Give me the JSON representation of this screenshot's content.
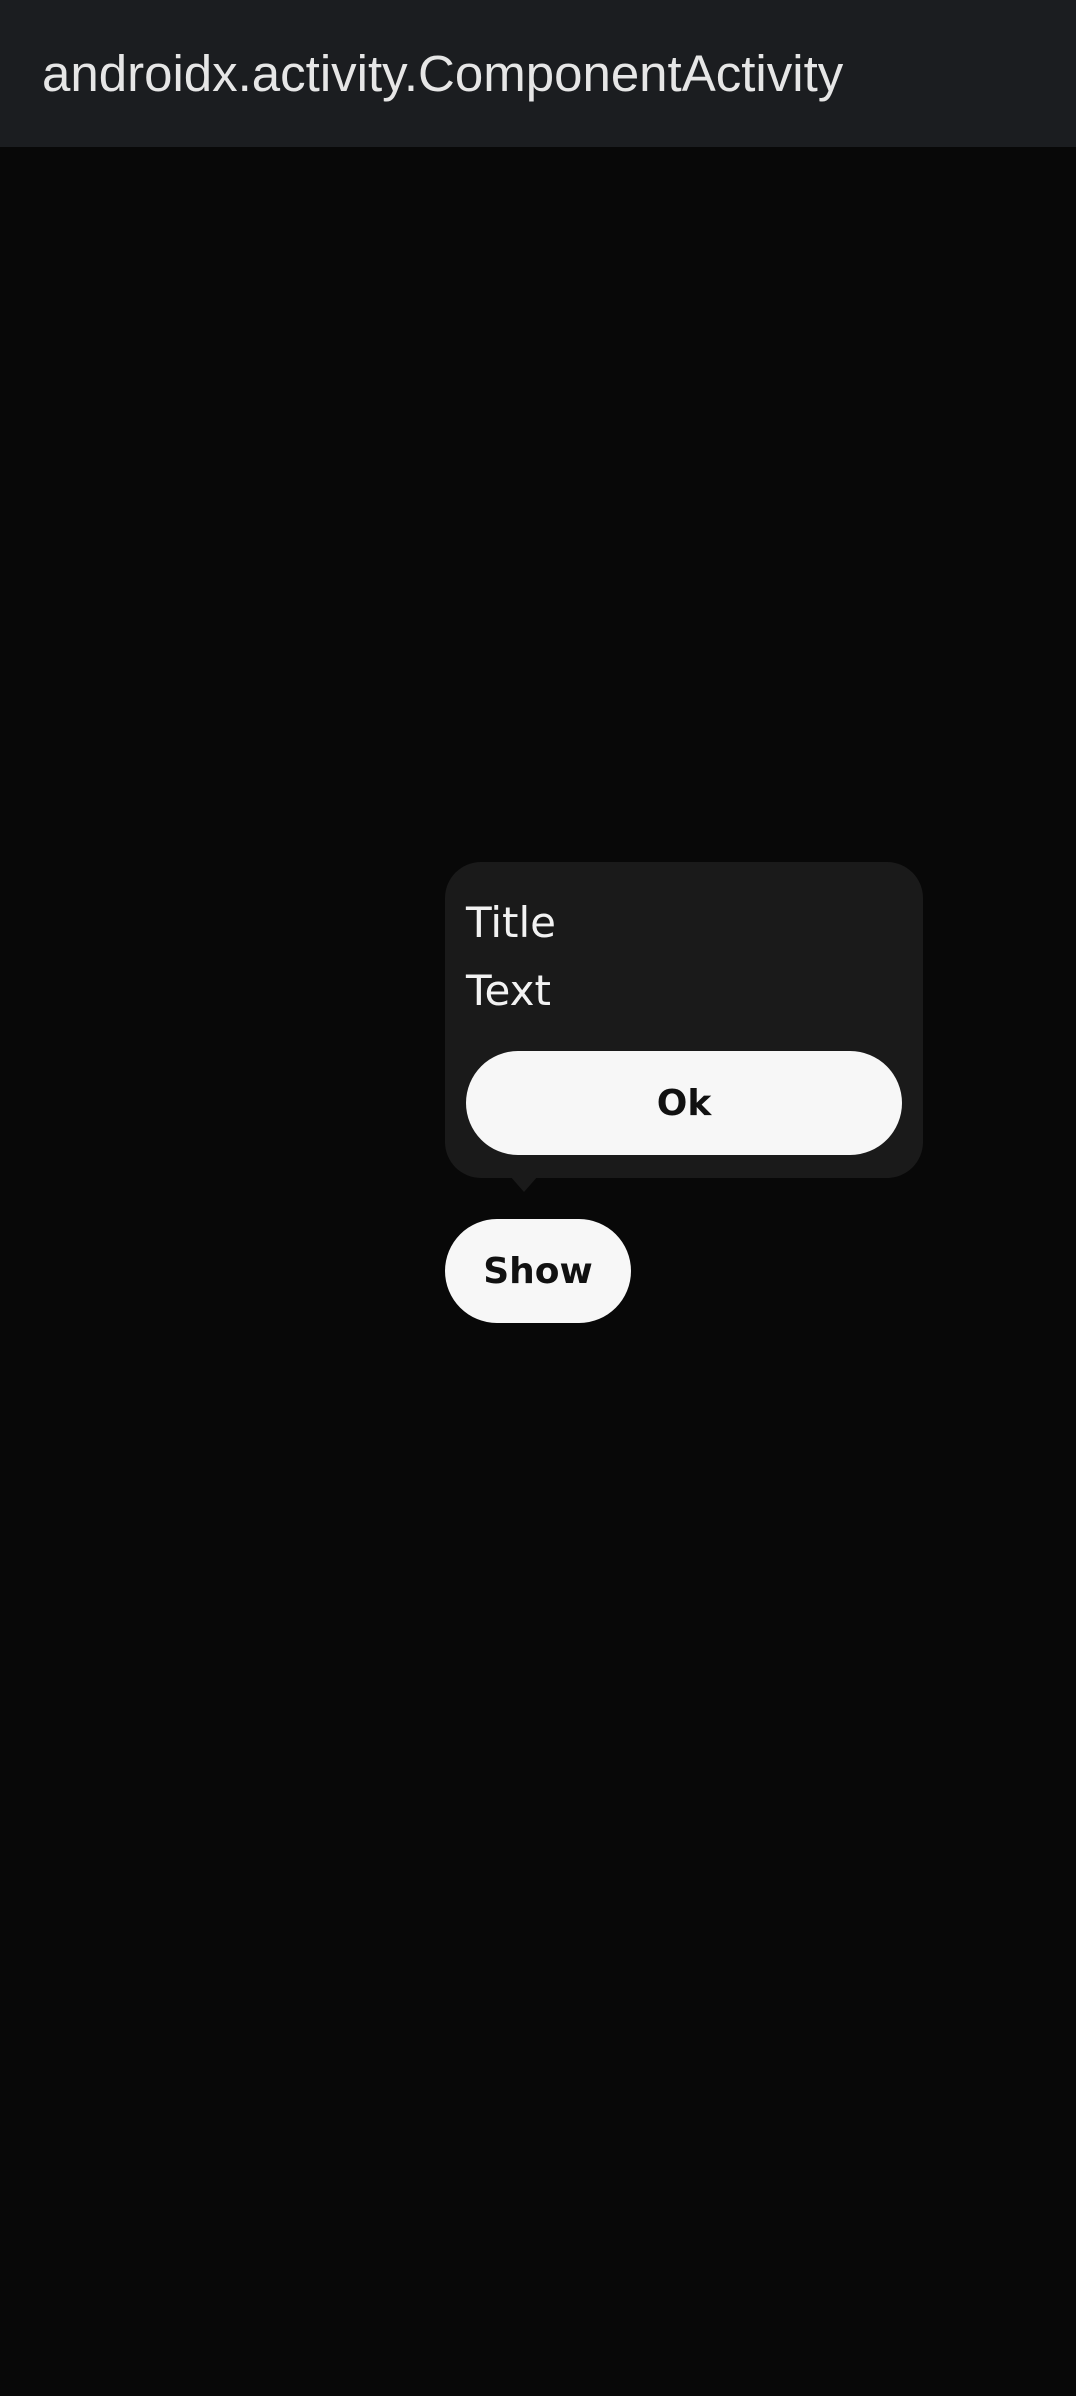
{
  "app_bar": {
    "title": "androidx.activity.ComponentActivity"
  },
  "tooltip": {
    "title": "Title",
    "text": "Text",
    "ok_label": "Ok"
  },
  "main": {
    "show_label": "Show"
  },
  "colors": {
    "app_bar_background": "#1b1d20",
    "screen_background": "#080808",
    "tooltip_background": "#1a1a1a",
    "button_background": "#f7f7f7",
    "button_text": "#111111",
    "primary_text": "#f2f2f2"
  }
}
